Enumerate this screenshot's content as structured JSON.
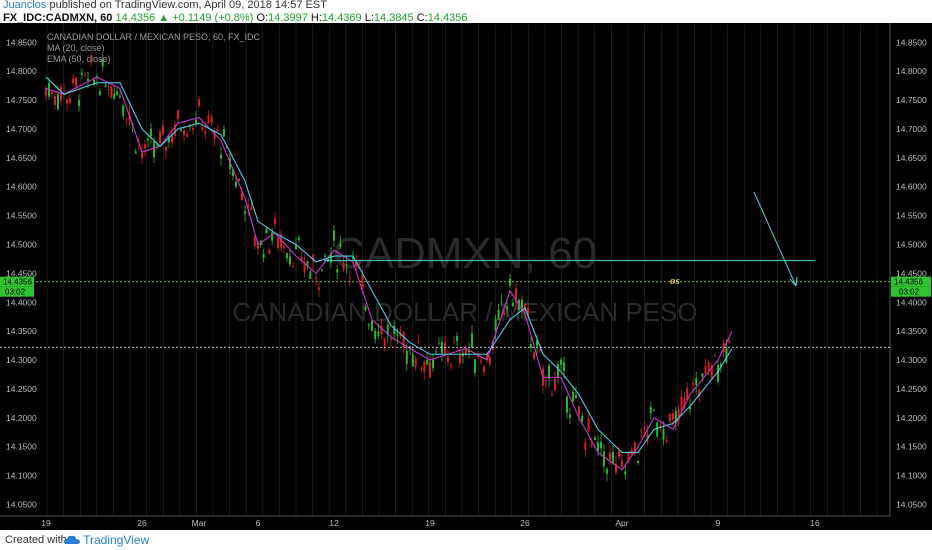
{
  "header": {
    "author": "Juanclos",
    "published_text": "published on TradingView.com, April 09, 2018 14:57 EST",
    "symbol": "FX_IDC:CADMXN, 60",
    "last": "14.4356",
    "change": "▲ +0.1149 (+0.8%)",
    "o_label": "O:",
    "o_value": "14.3997",
    "h_label": "H:",
    "h_value": "14.4369",
    "l_label": "L:",
    "l_value": "14.3845",
    "c_label": "C:",
    "c_value": "14.4356"
  },
  "footer": {
    "created_with": "Created with",
    "brand": "TradingView"
  },
  "chart_data": {
    "type": "line",
    "title": "CANADIAN DOLLAR / MEXICAN PESO, 60, FX_IDC",
    "watermark_symbol": "CADMXN, 60",
    "watermark_name": "CANADIAN DOLLAR / MEXICAN PESO",
    "indicators": [
      "MA (20, close)",
      "EMA (50, close)"
    ],
    "ylim": [
      14.03,
      14.88
    ],
    "y_ticks": [
      "14.0500",
      "14.1000",
      "14.1500",
      "14.2000",
      "14.2500",
      "14.3000",
      "14.3500",
      "14.4000",
      "14.4500",
      "14.5000",
      "14.5500",
      "14.6000",
      "14.6500",
      "14.7000",
      "14.7500",
      "14.8000",
      "14.8500"
    ],
    "x_ticks": [
      "19",
      "26",
      "Mar",
      "6",
      "12",
      "19",
      "26",
      "Apr",
      "9",
      "16"
    ],
    "current_price_label": "14.4356",
    "current_price": 14.4356,
    "countdown_label": "03:02",
    "resistance_level": 14.472,
    "support_level": 14.322,
    "annotation_text": "os",
    "series": [
      {
        "name": "MA (20, close)",
        "points": [
          [
            "Feb 19",
            14.77
          ],
          [
            "Feb 21",
            14.76
          ],
          [
            "Feb 22",
            14.79
          ],
          [
            "Feb 23",
            14.77
          ],
          [
            "Feb 26",
            14.66
          ],
          [
            "Feb 27",
            14.67
          ],
          [
            "Feb 28",
            14.71
          ],
          [
            "Mar 1",
            14.72
          ],
          [
            "Mar 2",
            14.68
          ],
          [
            "Mar 5",
            14.58
          ],
          [
            "Mar 6",
            14.5
          ],
          [
            "Mar 7",
            14.52
          ],
          [
            "Mar 8",
            14.48
          ],
          [
            "Mar 9",
            14.45
          ],
          [
            "Mar 12",
            14.49
          ],
          [
            "Mar 13",
            14.47
          ],
          [
            "Mar 14",
            14.37
          ],
          [
            "Mar 15",
            14.34
          ],
          [
            "Mar 16",
            14.32
          ],
          [
            "Mar 19",
            14.3
          ],
          [
            "Mar 20",
            14.31
          ],
          [
            "Mar 21",
            14.32
          ],
          [
            "Mar 22",
            14.3
          ],
          [
            "Mar 23",
            14.42
          ],
          [
            "Mar 26",
            14.38
          ],
          [
            "Mar 27",
            14.27
          ],
          [
            "Mar 28",
            14.27
          ],
          [
            "Mar 29",
            14.2
          ],
          [
            "Mar 30",
            14.14
          ],
          [
            "Apr 2",
            14.11
          ],
          [
            "Apr 3",
            14.15
          ],
          [
            "Apr 4",
            14.2
          ],
          [
            "Apr 5",
            14.18
          ],
          [
            "Apr 6",
            14.24
          ],
          [
            "Apr 9",
            14.3
          ],
          [
            "Apr 10",
            14.35
          ]
        ]
      },
      {
        "name": "EMA (50, close)",
        "points": [
          [
            "Feb 19",
            14.79
          ],
          [
            "Feb 21",
            14.76
          ],
          [
            "Feb 22",
            14.78
          ],
          [
            "Feb 23",
            14.78
          ],
          [
            "Feb 26",
            14.7
          ],
          [
            "Feb 27",
            14.67
          ],
          [
            "Feb 28",
            14.7
          ],
          [
            "Mar 1",
            14.71
          ],
          [
            "Mar 2",
            14.69
          ],
          [
            "Mar 5",
            14.61
          ],
          [
            "Mar 6",
            14.54
          ],
          [
            "Mar 7",
            14.52
          ],
          [
            "Mar 8",
            14.5
          ],
          [
            "Mar 9",
            14.47
          ],
          [
            "Mar 12",
            14.48
          ],
          [
            "Mar 13",
            14.48
          ],
          [
            "Mar 14",
            14.42
          ],
          [
            "Mar 15",
            14.36
          ],
          [
            "Mar 16",
            14.33
          ],
          [
            "Mar 19",
            14.31
          ],
          [
            "Mar 20",
            14.31
          ],
          [
            "Mar 21",
            14.31
          ],
          [
            "Mar 22",
            14.31
          ],
          [
            "Mar 23",
            14.37
          ],
          [
            "Mar 26",
            14.39
          ],
          [
            "Mar 27",
            14.31
          ],
          [
            "Mar 28",
            14.28
          ],
          [
            "Mar 29",
            14.24
          ],
          [
            "Mar 30",
            14.18
          ],
          [
            "Apr 2",
            14.14
          ],
          [
            "Apr 3",
            14.14
          ],
          [
            "Apr 4",
            14.18
          ],
          [
            "Apr 5",
            14.19
          ],
          [
            "Apr 6",
            14.22
          ],
          [
            "Apr 9",
            14.28
          ],
          [
            "Apr 10",
            14.32
          ]
        ]
      }
    ],
    "colors": {
      "background": "#000000",
      "up": "#2bb52b",
      "down": "#d32020",
      "ma": "#cc33cc",
      "ema": "#4fc7e8",
      "lines": "#4fd0d0",
      "price_line": "#7ed321",
      "text": "#bbbbbb"
    }
  }
}
